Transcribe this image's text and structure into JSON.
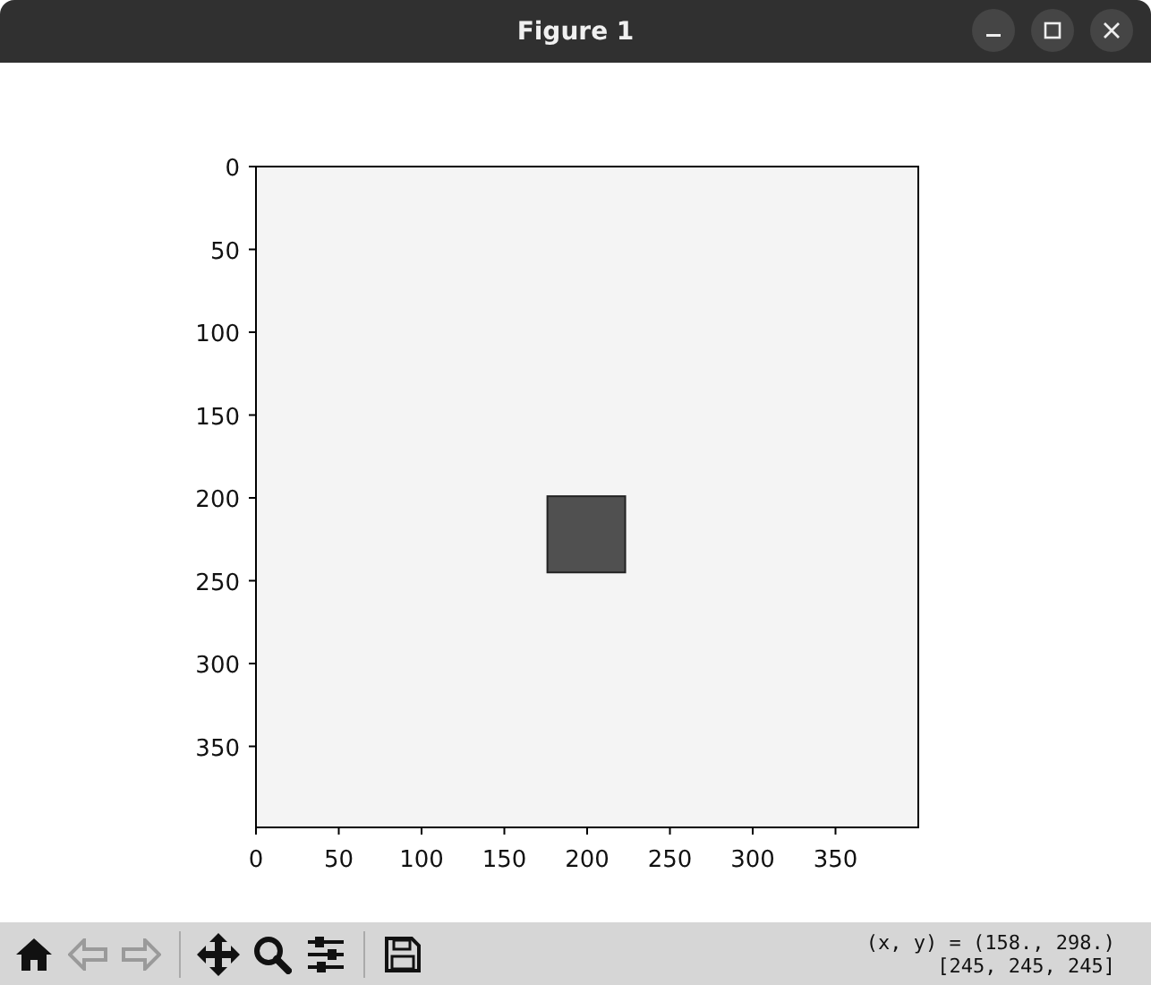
{
  "window": {
    "title": "Figure 1"
  },
  "axes": {
    "xticks": [
      "0",
      "50",
      "100",
      "150",
      "200",
      "250",
      "300",
      "350"
    ],
    "yticks": [
      "0",
      "50",
      "100",
      "150",
      "200",
      "250",
      "300",
      "350"
    ]
  },
  "toolbar": [
    {
      "kind": "home",
      "disabled": false
    },
    {
      "kind": "back",
      "disabled": true
    },
    {
      "kind": "forward",
      "disabled": true
    },
    {
      "kind": "separator"
    },
    {
      "kind": "pan",
      "disabled": false
    },
    {
      "kind": "zoom",
      "disabled": false
    },
    {
      "kind": "configure",
      "disabled": false
    },
    {
      "kind": "separator"
    },
    {
      "kind": "save",
      "disabled": false
    }
  ],
  "status": {
    "coordinates": "(x, y) = (158., 298.)",
    "pixel_value": "[245, 245, 245]"
  }
}
